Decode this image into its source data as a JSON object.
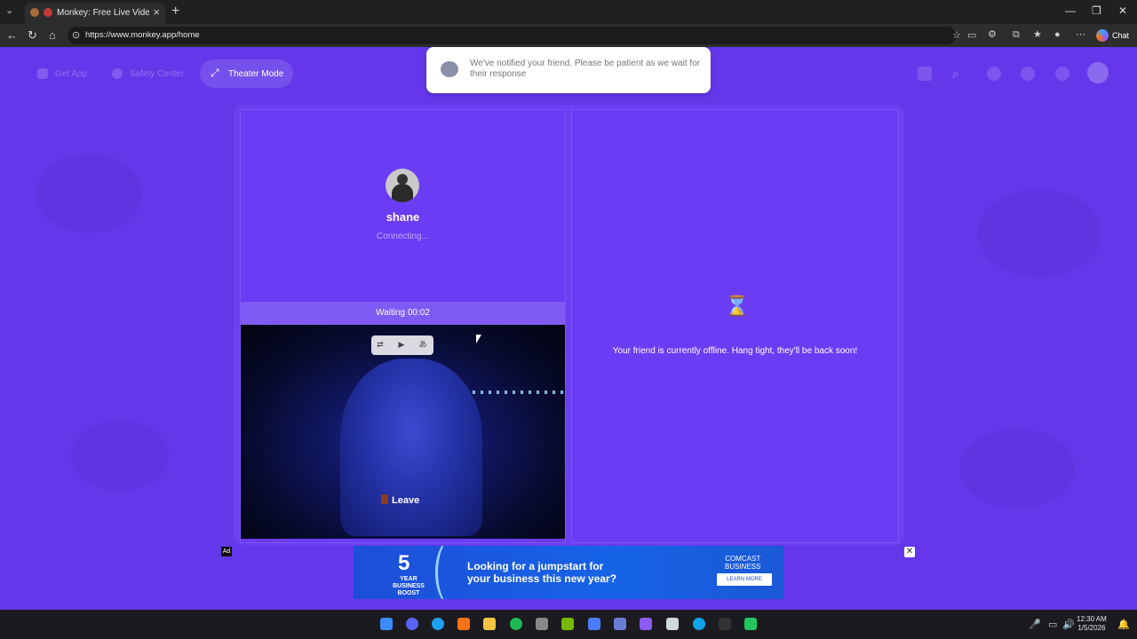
{
  "browser": {
    "tab_title": "Monkey: Free Live Video Chat",
    "tab_close": "×",
    "new_tab": "+",
    "url": "https://www.monkey.app/home",
    "chat_label": "Chat",
    "window_controls": {
      "minimize": "—",
      "restore": "❐",
      "close": "✕"
    }
  },
  "topnav": {
    "get_app": "Get App",
    "safety_center": "Safety Center",
    "theater_mode": "Theater Mode"
  },
  "notification": {
    "text": "We've notified your friend. Please be patient as we wait for their response"
  },
  "call": {
    "username": "shane",
    "status": "Connecting...",
    "waiting": "Waiting 00:02",
    "leave": "Leave",
    "offline_message": "Your friend is currently offline. Hang tight, they'll be back soon!",
    "hourglass": "⌛"
  },
  "ad": {
    "label": "Ad",
    "close": "✕",
    "big_number": "5",
    "boost_line1": "YEAR",
    "boost_line2": "BUSINESS",
    "boost_line3": "BOOST",
    "headline_line1": "Looking for a jumpstart for",
    "headline_line2": "your business this new year?",
    "brand_line1": "COMCAST",
    "brand_line2": "BUSINESS",
    "cta": "LEARN MORE"
  },
  "taskbar": {
    "time": "12:30 AM",
    "date": "1/5/2026"
  }
}
